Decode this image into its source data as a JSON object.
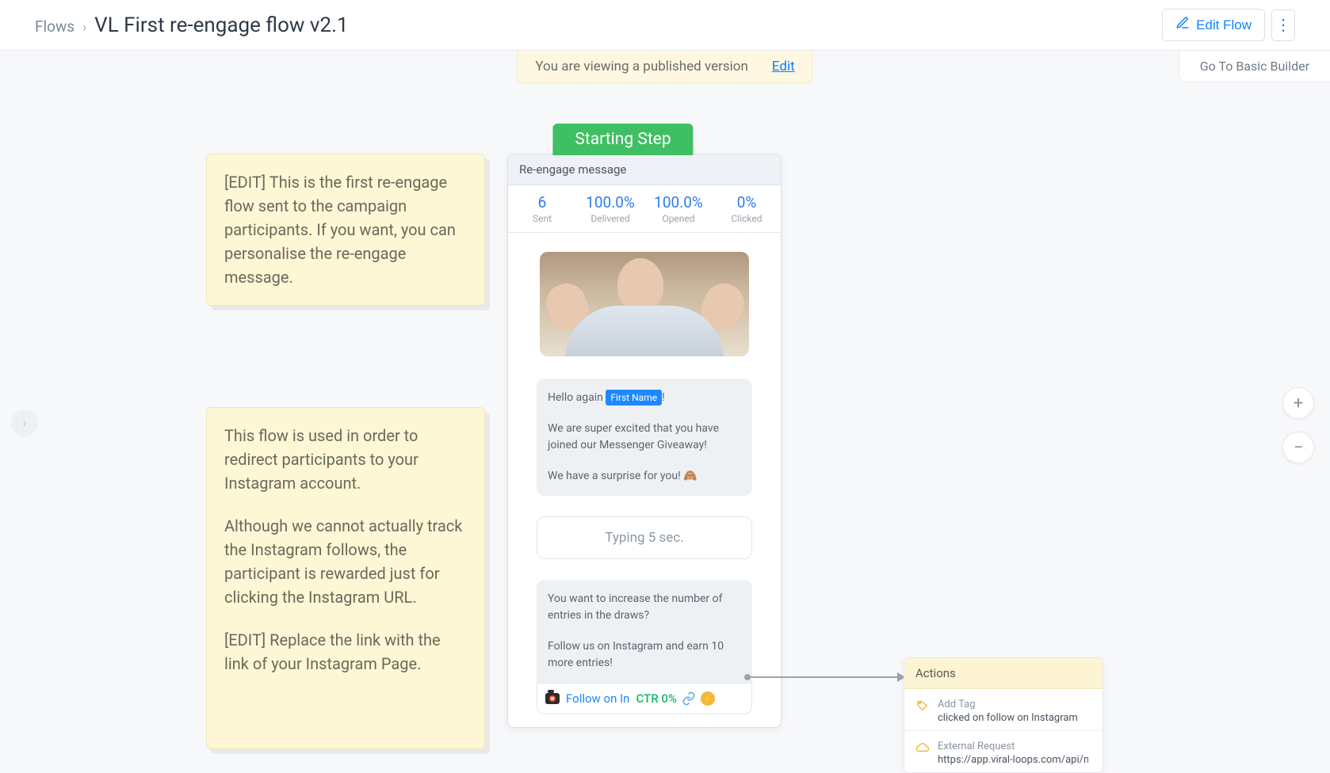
{
  "breadcrumb": {
    "root": "Flows",
    "title": "VL First re-engage flow v2.1"
  },
  "topbar": {
    "edit_flow": "Edit Flow"
  },
  "banner": {
    "text": "You are viewing a published version",
    "edit": "Edit"
  },
  "basic_builder": "Go To Basic Builder",
  "notes": {
    "n1": "[EDIT] This is the first re-engage flow sent to the campaign participants. If you want, you can personalise the re-engage message.",
    "n2a": "This flow is used in order to redirect participants to your Instagram account.",
    "n2b": "Although we cannot actually track the Instagram follows, the participant is rewarded just for clicking the Instagram URL.",
    "n2c": "[EDIT] Replace the link with the link of your Instagram Page."
  },
  "starting_step": "Starting Step",
  "card": {
    "title": "Re-engage message",
    "stats": {
      "sent_val": "6",
      "sent_lab": "Sent",
      "delivered_val": "100.0%",
      "delivered_lab": "Delivered",
      "opened_val": "100.0%",
      "opened_lab": "Opened",
      "clicked_val": "0%",
      "clicked_lab": "Clicked"
    },
    "bubble1": {
      "hello": "Hello again ",
      "var": "First Name",
      "excl": "!",
      "p2": "We are super excited that you have joined our Messenger Giveaway!",
      "p3": "We have a surprise for you! 🙈"
    },
    "typing": "Typing 5 sec.",
    "bubble2": {
      "p1": "You want to increase the number of entries in the draws?",
      "p2": "Follow us on Instagram and earn 10 more entries!"
    },
    "cta": {
      "label": "Follow on In",
      "ctr": "CTR 0%"
    }
  },
  "actions": {
    "header": "Actions",
    "item1_title": "Add Tag",
    "item1_sub": "clicked on follow on Instagram",
    "item2_title": "External Request",
    "item2_sub": "https://app.viral-loops.com/api/m"
  }
}
